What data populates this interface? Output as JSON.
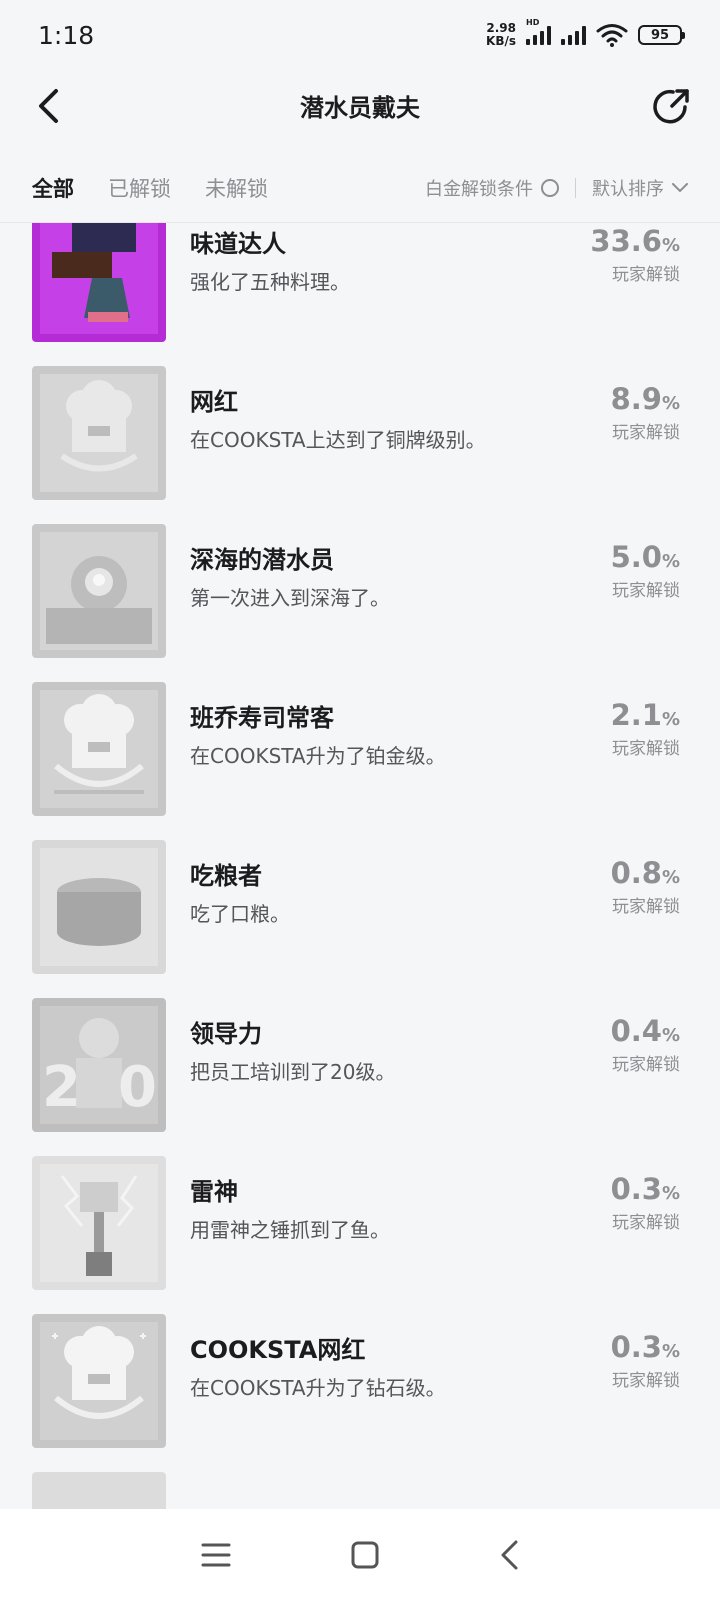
{
  "status_bar": {
    "time": "1:18",
    "net_speed_value": "2.98",
    "net_speed_unit": "KB/s",
    "hd": "HD",
    "battery": "95"
  },
  "header": {
    "title": "潜水员戴夫"
  },
  "filters": {
    "tabs": [
      "全部",
      "已解锁",
      "未解锁"
    ],
    "platinum_label": "白金解锁条件",
    "sort_label": "默认排序"
  },
  "achievements": [
    {
      "title": "味道达人",
      "desc": "强化了五种料理。",
      "value": "33.6",
      "pct": "%",
      "label": "玩家解锁",
      "icon": "purple-dish-icon"
    },
    {
      "title": "网红",
      "desc": "在COOKSTA上达到了铜牌级别。",
      "value": "8.9",
      "pct": "%",
      "label": "玩家解锁",
      "icon": "chef-hat-bronze-icon"
    },
    {
      "title": "深海的潜水员",
      "desc": "第一次进入到深海了。",
      "value": "5.0",
      "pct": "%",
      "label": "玩家解锁",
      "icon": "deep-sea-diver-icon"
    },
    {
      "title": "班乔寿司常客",
      "desc": "在COOKSTA升为了铂金级。",
      "value": "2.1",
      "pct": "%",
      "label": "玩家解锁",
      "icon": "chef-hat-platinum-icon"
    },
    {
      "title": "吃粮者",
      "desc": "吃了口粮。",
      "value": "0.8",
      "pct": "%",
      "label": "玩家解锁",
      "icon": "ration-can-icon"
    },
    {
      "title": "领导力",
      "desc": "把员工培训到了20级。",
      "value": "0.4",
      "pct": "%",
      "label": "玩家解锁",
      "icon": "staff-level-20-icon"
    },
    {
      "title": "雷神",
      "desc": "用雷神之锤抓到了鱼。",
      "value": "0.3",
      "pct": "%",
      "label": "玩家解锁",
      "icon": "thor-hammer-icon"
    },
    {
      "title": "COOKSTA网红",
      "desc": "在COOKSTA升为了钻石级。",
      "value": "0.3",
      "pct": "%",
      "label": "玩家解锁",
      "icon": "chef-hat-diamond-icon"
    }
  ],
  "colors": {
    "background": "#f5f6f8",
    "locked_icon_bg": "#d2d2d2",
    "unlocked_icon_bg": "#b52bd6"
  }
}
